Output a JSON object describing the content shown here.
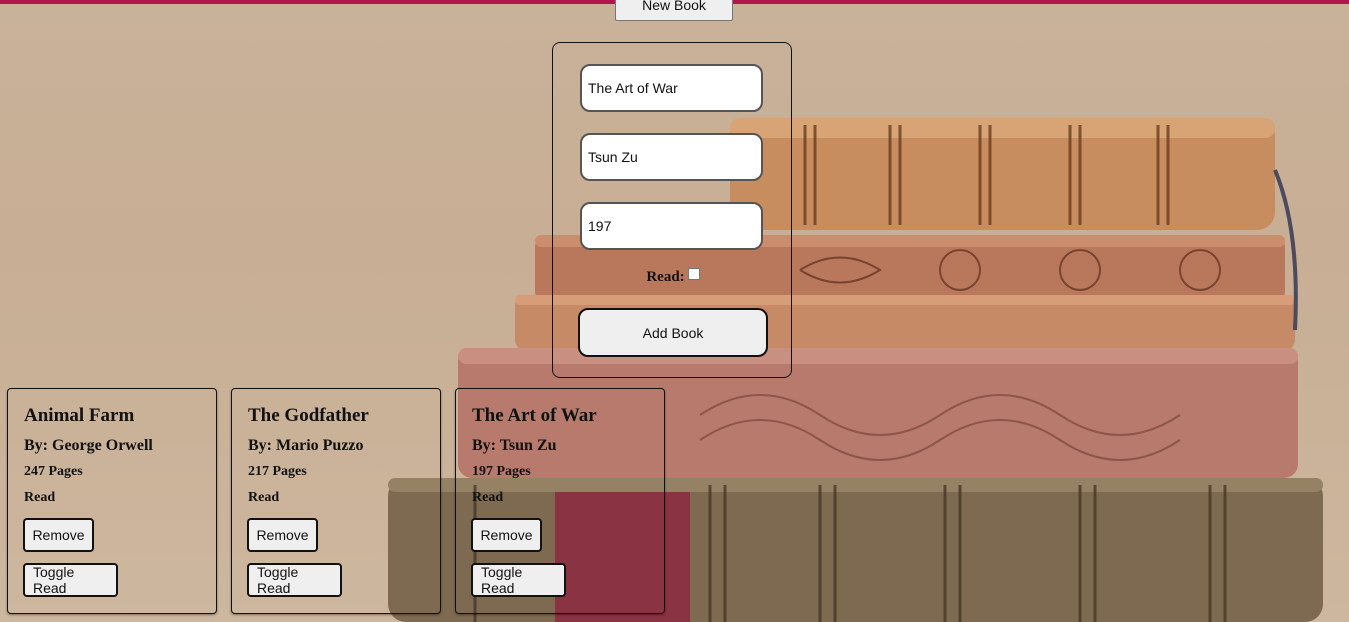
{
  "header": {
    "new_book_label": "New Book"
  },
  "form": {
    "title_value": "The Art of War",
    "author_value": "Tsun Zu",
    "pages_value": "197",
    "read_label": "Read:",
    "read_checked": false,
    "add_label": "Add Book"
  },
  "books": [
    {
      "title": "Animal Farm",
      "author": "By: George Orwell",
      "pages": "247 Pages",
      "status": "Read",
      "remove_label": "Remove",
      "toggle_label": "Toggle Read"
    },
    {
      "title": "The Godfather",
      "author": "By: Mario Puzzo",
      "pages": "217 Pages",
      "status": "Read",
      "remove_label": "Remove",
      "toggle_label": "Toggle Read"
    },
    {
      "title": "The Art of War",
      "author": "By: Tsun Zu",
      "pages": "197 Pages",
      "status": "Read",
      "remove_label": "Remove",
      "toggle_label": "Toggle Read"
    }
  ],
  "colors": {
    "accent_bar": "#b3164e",
    "button_bg": "#efefef"
  }
}
